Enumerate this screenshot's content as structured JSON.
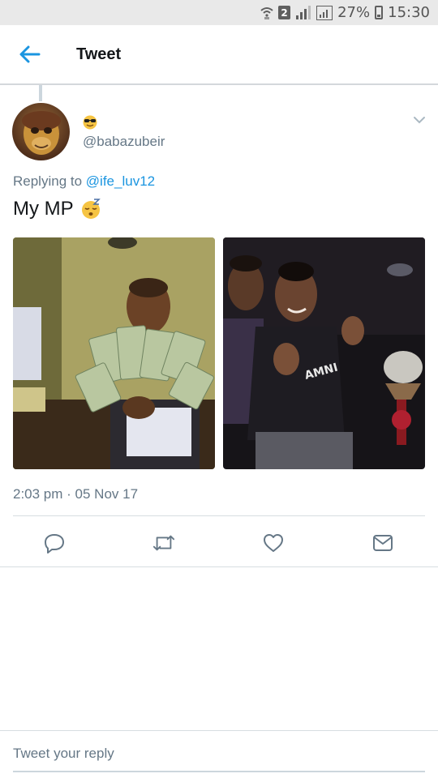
{
  "status_bar": {
    "sim_label": "2",
    "battery_percent": "27%",
    "time": "15:30",
    "icons": [
      "wifi-icon",
      "sim-icon",
      "signal-icon",
      "signal-icon-2",
      "battery-icon"
    ]
  },
  "header": {
    "title": "Tweet",
    "back_icon": "arrow-left-icon",
    "accent_color": "#1b95e0"
  },
  "tweet": {
    "display_name_emoji": "😎",
    "handle": "@babazubeir",
    "replying_prefix": "Replying to",
    "replying_to": "@ife_luv12",
    "text": "My MP",
    "text_emoji": "😴",
    "media": [
      {
        "name": "photo-man-with-cash"
      },
      {
        "name": "photo-couple-at-lounge"
      }
    ],
    "timestamp": "2:03 pm · 05 Nov 17",
    "actions": [
      "reply-icon",
      "retweet-icon",
      "like-icon",
      "direct-message-icon"
    ]
  },
  "reply_composer": {
    "placeholder": "Tweet your reply"
  }
}
